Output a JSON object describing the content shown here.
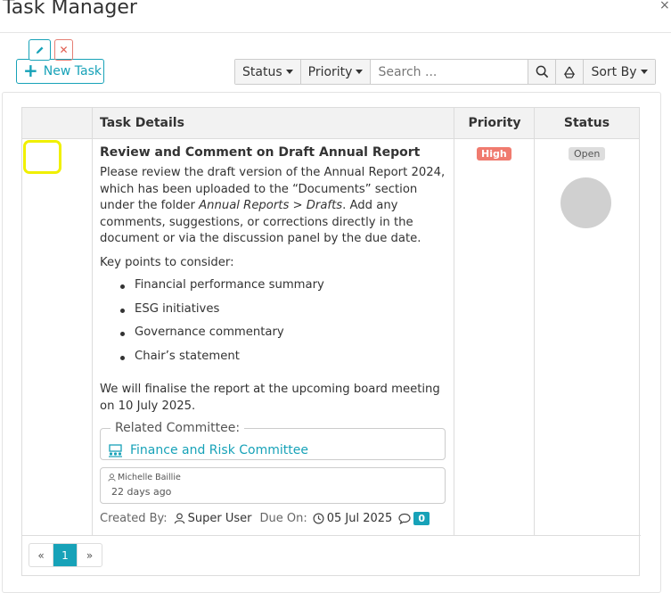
{
  "header": {
    "title": "Task Manager",
    "close": "×"
  },
  "toolbar": {
    "new_task": "New Task",
    "status": "Status",
    "priority": "Priority",
    "search_placeholder": "Search ...",
    "sort_by": "Sort By"
  },
  "table": {
    "columns": [
      "Task Details",
      "Priority",
      "Status"
    ]
  },
  "task": {
    "title": "Review and Comment on Draft Annual Report",
    "desc_part1": "Please review the draft version of the Annual Report 2024, which has been uploaded to the “Documents” section under the folder ",
    "desc_italic": "Annual Reports > Drafts",
    "desc_part2": ". Add any comments, suggestions, or corrections directly in the document or via the discussion panel by the due date.",
    "key_points_label": "Key points to consider:",
    "key_points": [
      "Financial performance summary",
      "ESG initiatives",
      "Governance commentary",
      "Chair’s statement"
    ],
    "final_note": "We will finalise the report at the upcoming board meeting on 10 July 2025.",
    "related_label": "Related Committee:",
    "committee": "Finance and Risk Committee",
    "comment_user": "Michelle Baillie",
    "comment_time": "22 days ago",
    "created_by_label": "Created By:",
    "created_by": "Super User",
    "due_label": "Due On:",
    "due_date": "05 Jul 2025",
    "comment_count": "0",
    "priority": "High",
    "status": "Open"
  },
  "pager": {
    "prev": "«",
    "page": "1",
    "next": "»"
  },
  "colors": {
    "accent": "#17a2b8",
    "danger": "#f07b6f",
    "highlight": "#f0f000"
  }
}
